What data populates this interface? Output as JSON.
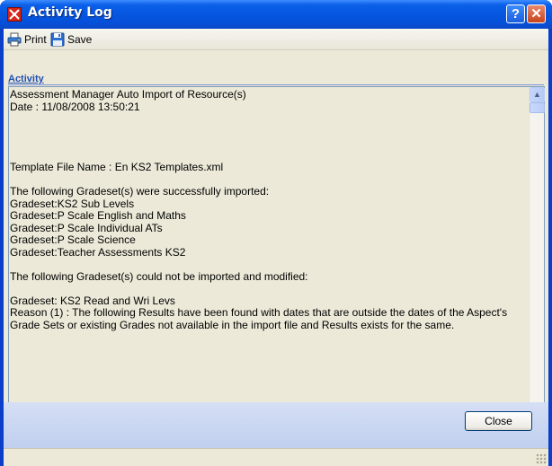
{
  "window": {
    "title": "Activity Log",
    "help_glyph": "?",
    "close_glyph": "✕"
  },
  "toolbar": {
    "print_label": "Print",
    "save_label": "Save"
  },
  "section": {
    "label": "Activity"
  },
  "log": {
    "lines": [
      "Assessment Manager Auto Import of Resource(s)",
      "Date : 11/08/2008 13:50:21",
      "",
      "",
      "",
      "",
      "Template File Name : En KS2 Templates.xml",
      "",
      "The following Gradeset(s) were successfully imported:",
      "Gradeset:KS2 Sub Levels",
      "Gradeset:P Scale English and Maths",
      "Gradeset:P Scale Individual ATs",
      "Gradeset:P Scale Science",
      "Gradeset:Teacher Assessments KS2",
      "",
      "The following Gradeset(s) could not be imported and modified:",
      "",
      "Gradeset: KS2 Read and Wri Levs",
      "Reason (1) : The following Results have been found with dates that are outside the dates of the Aspect's Grade Sets or existing Grades not available in the import file and Results exists for the same."
    ]
  },
  "footer": {
    "close_label": "Close"
  },
  "colors": {
    "titlebar": "#0656e0",
    "client": "#ece9d8",
    "accent": "#1f4fb5"
  },
  "icons": [
    "app-icon",
    "printer-icon",
    "floppy-disk-icon",
    "help-icon",
    "close-icon",
    "scroll-up-icon",
    "scroll-down-icon",
    "resize-grip-icon"
  ]
}
